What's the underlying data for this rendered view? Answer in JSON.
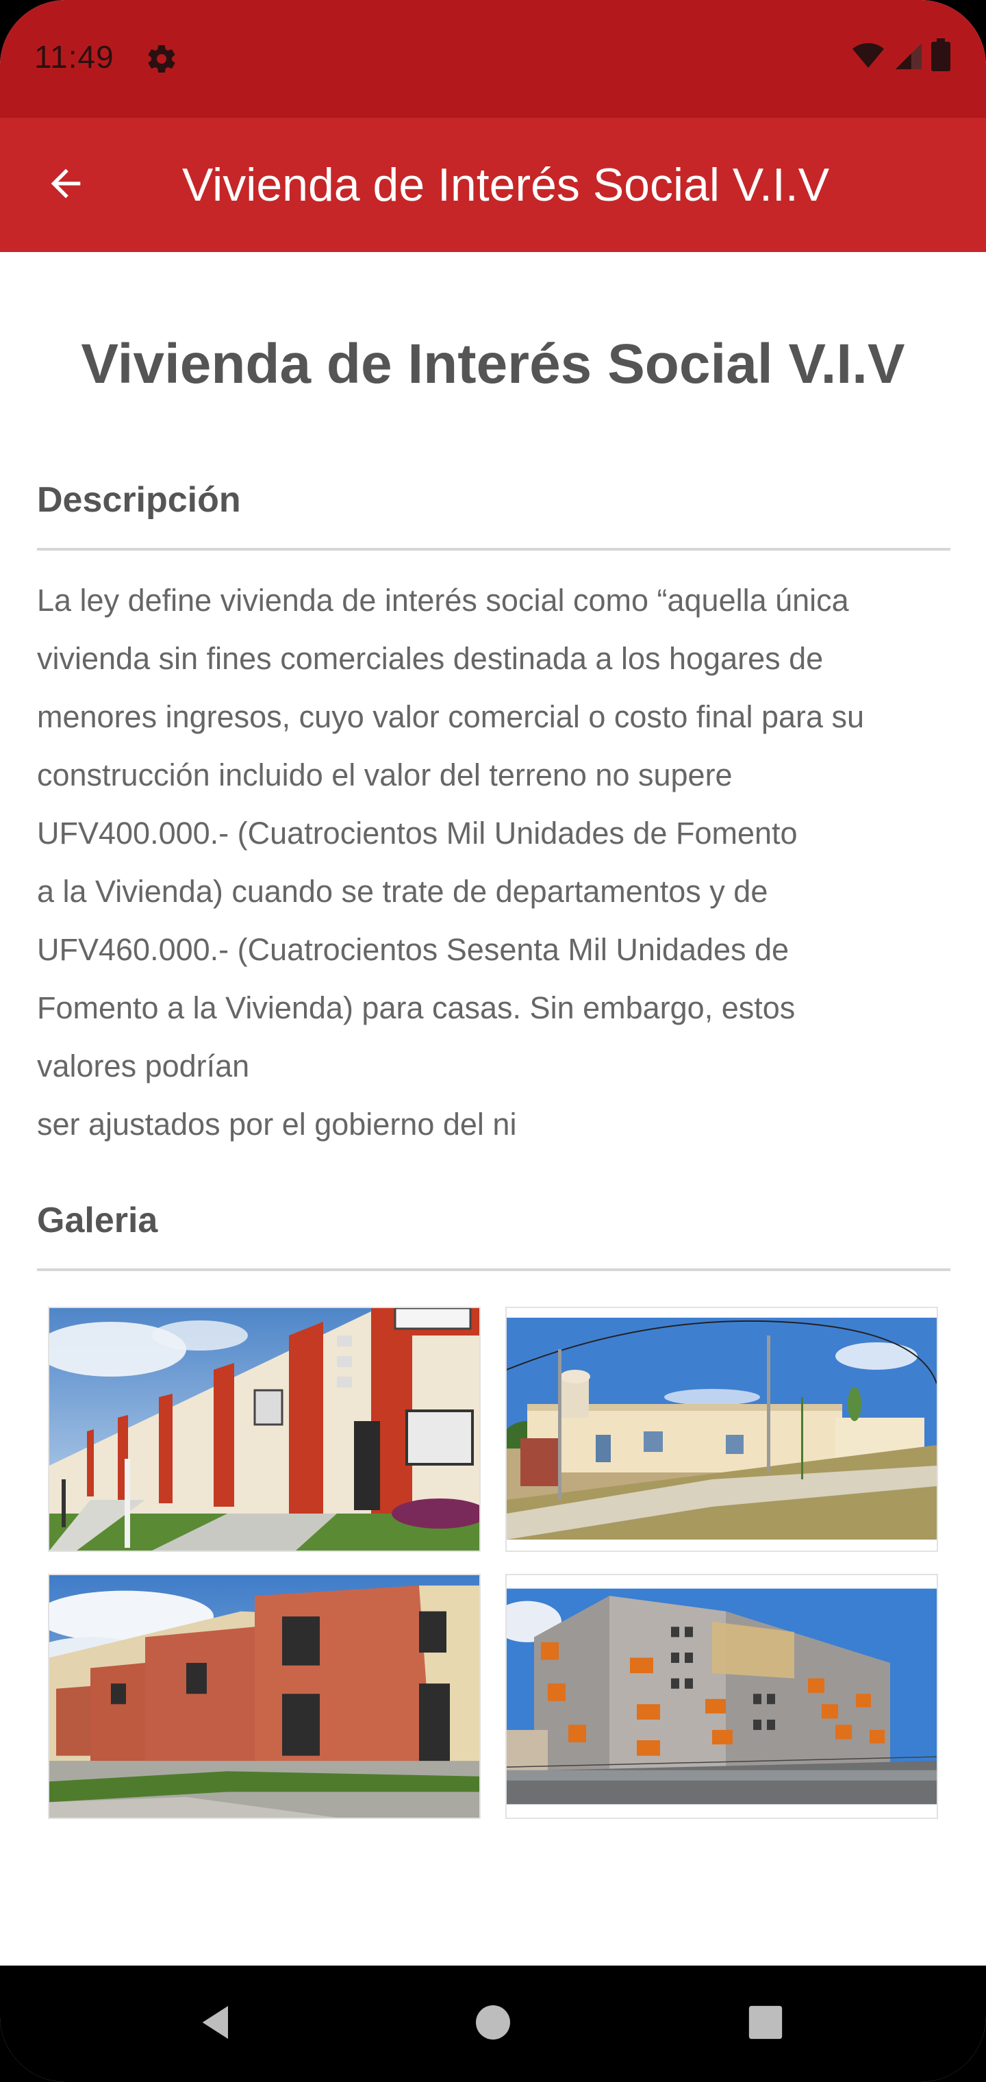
{
  "status_bar": {
    "time": "11:49",
    "left_icons": [
      "gear-icon"
    ],
    "right_icons": [
      "wifi-icon",
      "signal-icon",
      "battery-icon"
    ],
    "background_color": "#b3191c"
  },
  "app_bar": {
    "title": "Vivienda de Interés Social V.I.V",
    "back_icon": "arrow-back-icon",
    "background_color": "#c62628"
  },
  "page": {
    "title": "Vivienda de Interés Social V.I.V"
  },
  "description": {
    "heading": "Descripción",
    "lines": [
      "La ley define vivienda de interés social como “aquella única",
      "vivienda sin fines comerciales destinada a los hogares de",
      "menores ingresos, cuyo valor comercial o costo final para su",
      "construcción incluido el valor del terreno no supere",
      "UFV400.000.- (Cuatrocientos Mil Unidades de  Fomento",
      "a la Vivienda) cuando se trate de departamentos y de",
      "UFV460.000.- (Cuatrocientos  Sesenta Mil Unidades de",
      "Fomento a la Vivienda) para casas. Sin embargo, estos",
      "valores podrían",
      "ser ajustados por el gobierno del ni"
    ]
  },
  "gallery": {
    "heading": "Galeria",
    "images": [
      "townhouse-row-image",
      "single-story-houses-image",
      "brick-houses-image",
      "apartment-building-image"
    ]
  },
  "nav_bar": {
    "icons": [
      "back-triangle-icon",
      "home-circle-icon",
      "recents-square-icon"
    ]
  }
}
